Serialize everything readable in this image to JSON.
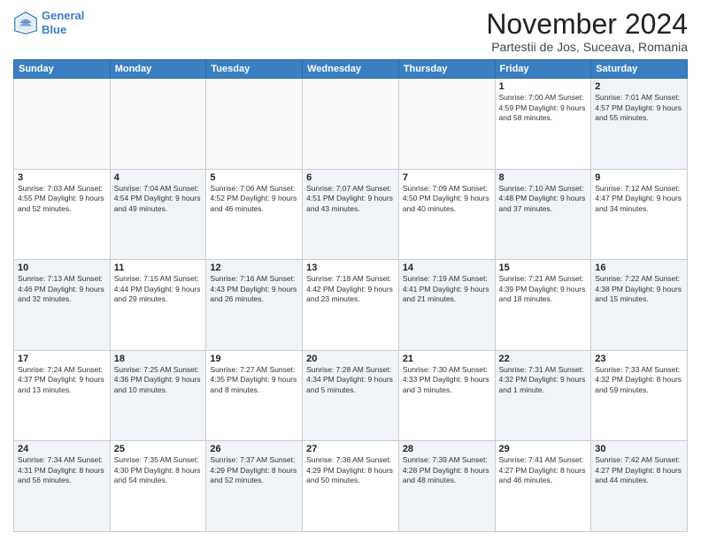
{
  "logo": {
    "line1": "General",
    "line2": "Blue"
  },
  "title": "November 2024",
  "subtitle": "Partestii de Jos, Suceava, Romania",
  "days_header": [
    "Sunday",
    "Monday",
    "Tuesday",
    "Wednesday",
    "Thursday",
    "Friday",
    "Saturday"
  ],
  "weeks": [
    [
      {
        "day": "",
        "info": ""
      },
      {
        "day": "",
        "info": ""
      },
      {
        "day": "",
        "info": ""
      },
      {
        "day": "",
        "info": ""
      },
      {
        "day": "",
        "info": ""
      },
      {
        "day": "1",
        "info": "Sunrise: 7:00 AM\nSunset: 4:59 PM\nDaylight: 9 hours and 58 minutes."
      },
      {
        "day": "2",
        "info": "Sunrise: 7:01 AM\nSunset: 4:57 PM\nDaylight: 9 hours and 55 minutes."
      }
    ],
    [
      {
        "day": "3",
        "info": "Sunrise: 7:03 AM\nSunset: 4:55 PM\nDaylight: 9 hours and 52 minutes."
      },
      {
        "day": "4",
        "info": "Sunrise: 7:04 AM\nSunset: 4:54 PM\nDaylight: 9 hours and 49 minutes."
      },
      {
        "day": "5",
        "info": "Sunrise: 7:06 AM\nSunset: 4:52 PM\nDaylight: 9 hours and 46 minutes."
      },
      {
        "day": "6",
        "info": "Sunrise: 7:07 AM\nSunset: 4:51 PM\nDaylight: 9 hours and 43 minutes."
      },
      {
        "day": "7",
        "info": "Sunrise: 7:09 AM\nSunset: 4:50 PM\nDaylight: 9 hours and 40 minutes."
      },
      {
        "day": "8",
        "info": "Sunrise: 7:10 AM\nSunset: 4:48 PM\nDaylight: 9 hours and 37 minutes."
      },
      {
        "day": "9",
        "info": "Sunrise: 7:12 AM\nSunset: 4:47 PM\nDaylight: 9 hours and 34 minutes."
      }
    ],
    [
      {
        "day": "10",
        "info": "Sunrise: 7:13 AM\nSunset: 4:46 PM\nDaylight: 9 hours and 32 minutes."
      },
      {
        "day": "11",
        "info": "Sunrise: 7:15 AM\nSunset: 4:44 PM\nDaylight: 9 hours and 29 minutes."
      },
      {
        "day": "12",
        "info": "Sunrise: 7:16 AM\nSunset: 4:43 PM\nDaylight: 9 hours and 26 minutes."
      },
      {
        "day": "13",
        "info": "Sunrise: 7:18 AM\nSunset: 4:42 PM\nDaylight: 9 hours and 23 minutes."
      },
      {
        "day": "14",
        "info": "Sunrise: 7:19 AM\nSunset: 4:41 PM\nDaylight: 9 hours and 21 minutes."
      },
      {
        "day": "15",
        "info": "Sunrise: 7:21 AM\nSunset: 4:39 PM\nDaylight: 9 hours and 18 minutes."
      },
      {
        "day": "16",
        "info": "Sunrise: 7:22 AM\nSunset: 4:38 PM\nDaylight: 9 hours and 15 minutes."
      }
    ],
    [
      {
        "day": "17",
        "info": "Sunrise: 7:24 AM\nSunset: 4:37 PM\nDaylight: 9 hours and 13 minutes."
      },
      {
        "day": "18",
        "info": "Sunrise: 7:25 AM\nSunset: 4:36 PM\nDaylight: 9 hours and 10 minutes."
      },
      {
        "day": "19",
        "info": "Sunrise: 7:27 AM\nSunset: 4:35 PM\nDaylight: 9 hours and 8 minutes."
      },
      {
        "day": "20",
        "info": "Sunrise: 7:28 AM\nSunset: 4:34 PM\nDaylight: 9 hours and 5 minutes."
      },
      {
        "day": "21",
        "info": "Sunrise: 7:30 AM\nSunset: 4:33 PM\nDaylight: 9 hours and 3 minutes."
      },
      {
        "day": "22",
        "info": "Sunrise: 7:31 AM\nSunset: 4:32 PM\nDaylight: 9 hours and 1 minute."
      },
      {
        "day": "23",
        "info": "Sunrise: 7:33 AM\nSunset: 4:32 PM\nDaylight: 8 hours and 59 minutes."
      }
    ],
    [
      {
        "day": "24",
        "info": "Sunrise: 7:34 AM\nSunset: 4:31 PM\nDaylight: 8 hours and 56 minutes."
      },
      {
        "day": "25",
        "info": "Sunrise: 7:35 AM\nSunset: 4:30 PM\nDaylight: 8 hours and 54 minutes."
      },
      {
        "day": "26",
        "info": "Sunrise: 7:37 AM\nSunset: 4:29 PM\nDaylight: 8 hours and 52 minutes."
      },
      {
        "day": "27",
        "info": "Sunrise: 7:38 AM\nSunset: 4:29 PM\nDaylight: 8 hours and 50 minutes."
      },
      {
        "day": "28",
        "info": "Sunrise: 7:39 AM\nSunset: 4:28 PM\nDaylight: 8 hours and 48 minutes."
      },
      {
        "day": "29",
        "info": "Sunrise: 7:41 AM\nSunset: 4:27 PM\nDaylight: 8 hours and 46 minutes."
      },
      {
        "day": "30",
        "info": "Sunrise: 7:42 AM\nSunset: 4:27 PM\nDaylight: 8 hours and 44 minutes."
      }
    ]
  ]
}
